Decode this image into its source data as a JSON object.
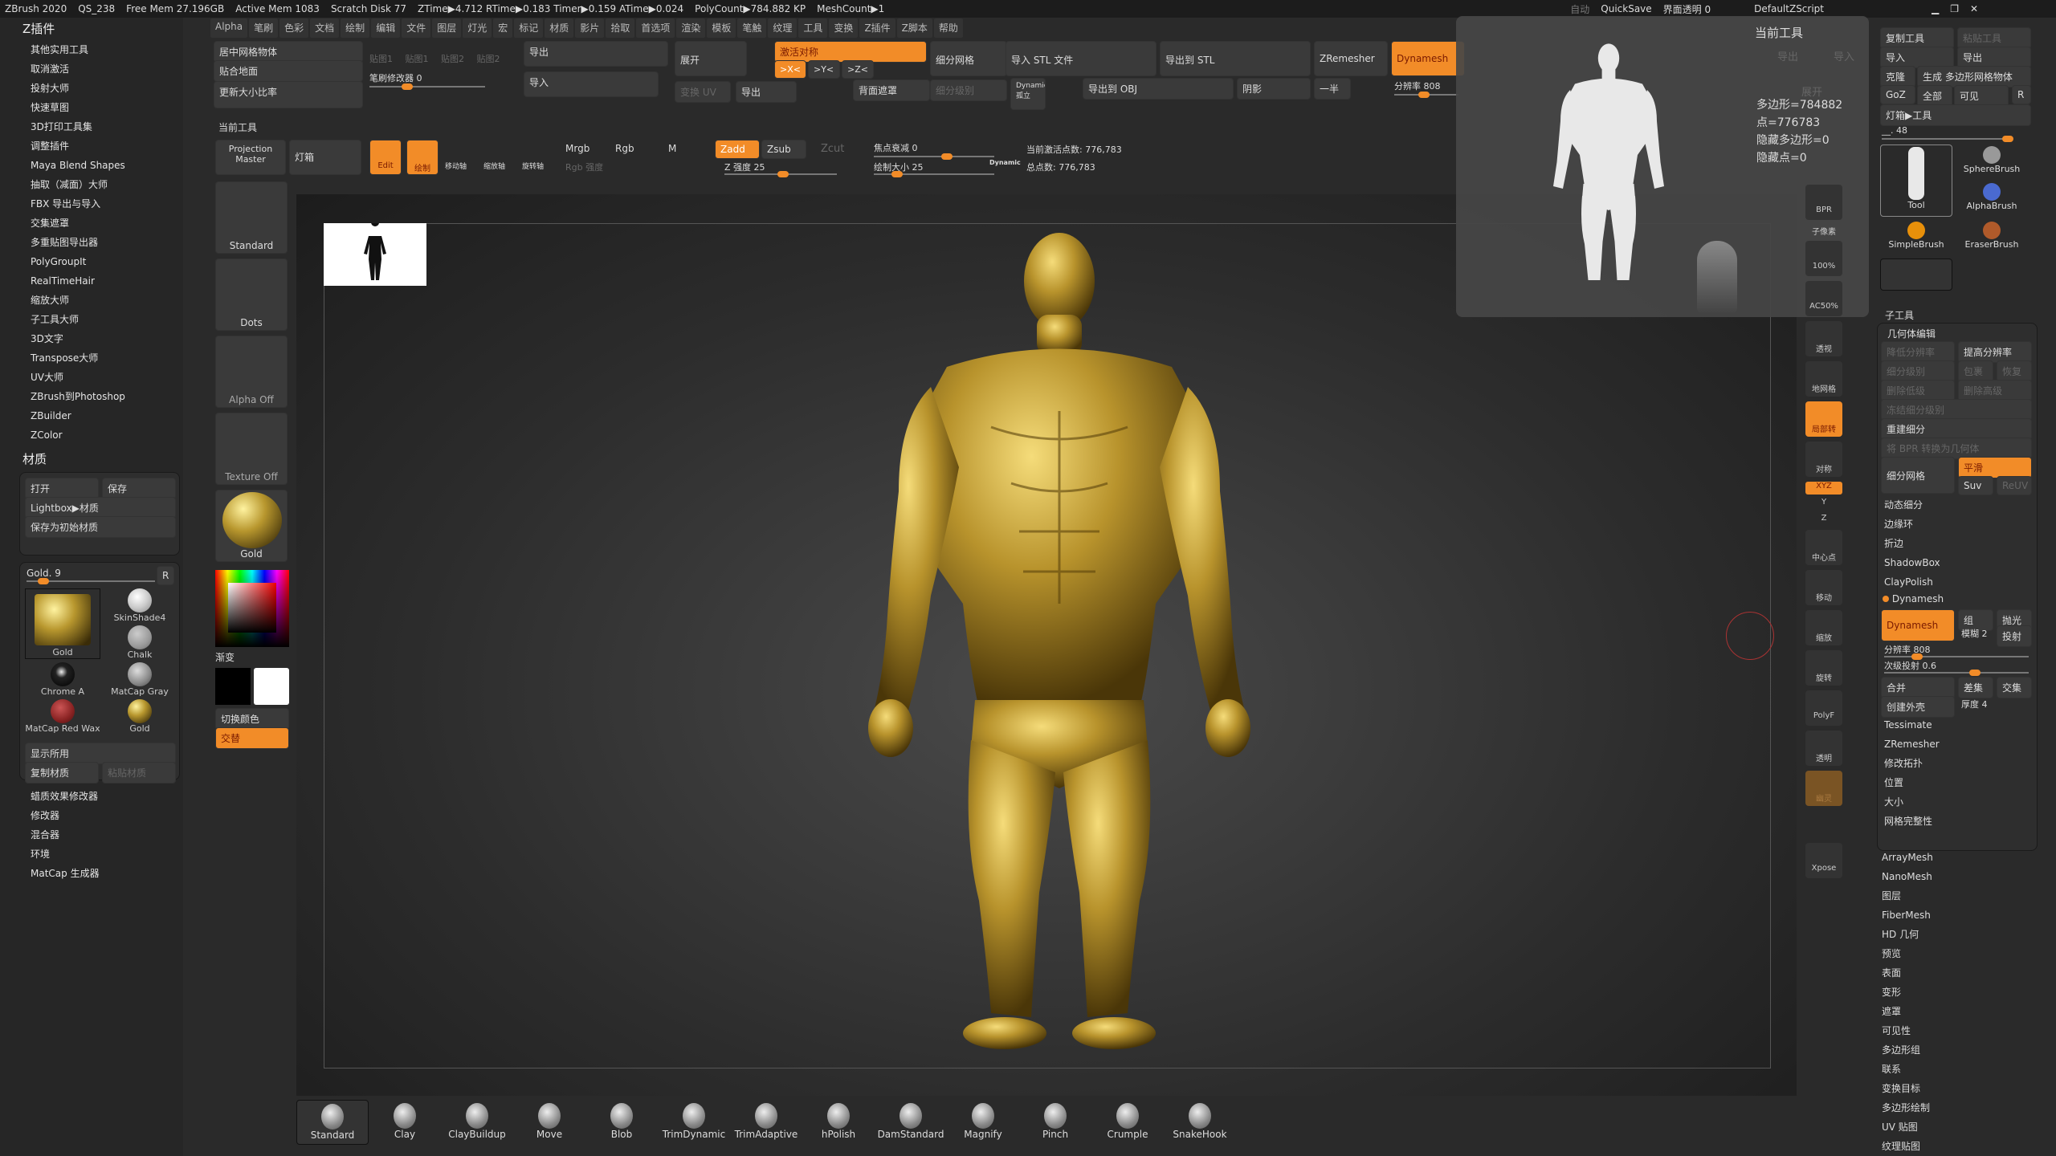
{
  "status": {
    "app": "ZBrush 2020",
    "qs": "QS_238",
    "free_mem": "Free Mem 27.196GB",
    "active_mem": "Active Mem 1083",
    "scratch": "Scratch Disk 77",
    "ztime": "ZTime▶4.712 RTime▶0.183 Timer▶0.159 ATime▶0.024",
    "polycount": "PolyCount▶784.882 KP",
    "meshcount": "MeshCount▶1",
    "auto": "自动",
    "quicksave": "QuickSave",
    "transparency": "界面透明 0",
    "script": "DefaultZScript"
  },
  "menu": [
    "Alpha",
    "笔刷",
    "色彩",
    "文档",
    "绘制",
    "编辑",
    "文件",
    "图层",
    "灯光",
    "宏",
    "标记",
    "材质",
    "影片",
    "拾取",
    "首选项",
    "渲染",
    "模板",
    "笔触",
    "纹理",
    "工具",
    "变换",
    "Z插件",
    "Z脚本",
    "帮助"
  ],
  "left": {
    "title": "Z插件",
    "plugins": [
      "其他实用工具",
      "取消激活",
      "投射大师",
      "快速草图",
      "3D打印工具集",
      "调整插件",
      "Maya Blend Shapes",
      "抽取（减面）大师",
      "FBX 导出与导入",
      "交集遮罩",
      "多重贴图导出器",
      "PolyGroupIt",
      "RealTimeHair",
      "缩放大师",
      "子工具大师",
      "3D文字",
      "Transpose大师",
      "UV大师",
      "ZBrush到Photoshop",
      "ZBuilder",
      "ZColor"
    ],
    "material_title": "材质",
    "open": "打开",
    "save": "保存",
    "lightbox": "Lightbox▶材质",
    "save_start": "保存为初始材质",
    "gold_slider": "Gold. 9",
    "r": "R",
    "materials": [
      "Gold",
      "SkinShade4",
      "Chalk",
      "Chrome A",
      "MatCap Gray",
      "MatCap Red Wax",
      "Gold"
    ],
    "show_used": "显示所用",
    "copy_mat": "复制材质",
    "paste_mat": "粘贴材质",
    "subs": [
      "蜡质效果修改器",
      "修改器",
      "混合器",
      "环境",
      "MatCap 生成器"
    ]
  },
  "top": {
    "center_mesh": "居中网格物体",
    "fit_ground": "贴合地面",
    "update_ratio": "更新大小比率",
    "maps": [
      "贴图1",
      "贴图1",
      "贴图2",
      "贴图2"
    ],
    "brush_mod": "笔刷修改器 0",
    "export": "导出",
    "import": "导入",
    "unwrap": "展开",
    "change_uv": "变换 UV",
    "export2": "导出",
    "activate_sym": "激活对称",
    "x": ">X<",
    "y": ">Y<",
    "z": ">Z<",
    "back_mask": "背面遮罩",
    "divide": "细分网格",
    "sdiv": "细分级别",
    "dynamic": "Dynamic",
    "solo": "孤立",
    "import_stl": "导入 STL 文件",
    "export_stl": "导出到 STL",
    "export_obj": "导出到 OBJ",
    "shadow": "阴影",
    "half": "一半",
    "zremesher": "ZRemesher",
    "dynamesh": "Dynamesh",
    "resolution": "分辨率 808"
  },
  "toolbar": {
    "label": "当前工具",
    "projection": "Projection Master",
    "lightbox": "灯箱",
    "edit": "Edit",
    "draw": "绘制",
    "move": "移动轴",
    "scale": "缩放轴",
    "rotate": "旋转轴",
    "mrgb": "Mrgb",
    "rgb": "Rgb",
    "m": "M",
    "rgb_int": "Rgb 强度",
    "zadd": "Zadd",
    "zsub": "Zsub",
    "zcut": "Zcut",
    "z_int": "Z 强度 25",
    "focal": "焦点衰减 0",
    "draw_size": "绘制大小 25",
    "dyn": "Dynamic",
    "active_pts": "当前激活点数: 776,783",
    "total_pts": "总点数: 776,783"
  },
  "shelf": {
    "brush": "Standard",
    "stroke": "Dots",
    "alpha": "Alpha Off",
    "texture": "Texture Off",
    "material": "Gold",
    "gradient": "渐变",
    "switch": "切换颜色",
    "alternate": "交替"
  },
  "popup": {
    "title": "当前工具",
    "export": "导出",
    "import": "导入",
    "unwrap": "展开",
    "polys": "多边形=784882",
    "points": "点=776783",
    "hidden_polys": "隐藏多边形=0",
    "hidden_pts": "隐藏点=0"
  },
  "rtool": [
    "BPR",
    "子像素",
    "100%",
    "AC50%",
    "透视",
    "地网格",
    "局部转",
    "对称",
    "XYZ",
    "Y",
    "Z",
    "中心点",
    "移动",
    "缩放",
    "旋转",
    "PolyF",
    "透明",
    "幽灵",
    "Xpose"
  ],
  "right": {
    "copy_tool": "复制工具",
    "paste_tool": "粘贴工具",
    "import": "导入",
    "export": "导出",
    "clone": "克隆",
    "make_poly": "生成 多边形网格物体",
    "goz": "GoZ",
    "all": "全部",
    "visible": "可见",
    "r": "R",
    "lightbox": "灯箱▶工具",
    "slider": "__. 48",
    "tools": [
      "Tool",
      "SphereBrush",
      "AlphaBrush",
      "SimpleBrush",
      "EraserBrush"
    ],
    "subtool": "子工具",
    "geometry": "几何体编辑",
    "lower": "降低分辨率",
    "higher": "提高分辨率",
    "sdiv": "细分级别",
    "cage": "包裹",
    "restore": "恢复",
    "del_lower": "删除低级",
    "del_higher": "删除高级",
    "freeze": "冻结细分级别",
    "reconstruct": "重建细分",
    "bpr": "将 BPR 转换为几何体",
    "divide": "细分网格",
    "smooth": "平滑",
    "suv": "Suv",
    "reuv": "ReUV",
    "geo_items": [
      "动态细分",
      "边缘环",
      "折边",
      "ShadowBox",
      "ClayPolish"
    ],
    "dynamesh": "Dynamesh",
    "group": "组",
    "polish": "抛光",
    "blur": "模糊 2",
    "project": "投射",
    "resolution": "分辨率 808",
    "subproj": "次级投射 0.6",
    "add": "合并",
    "sub": "差集",
    "intersect": "交集",
    "shell": "创建外壳",
    "thickness": "厚度 4",
    "geo_items2": [
      "Tessimate",
      "ZRemesher",
      "修改拓扑",
      "位置",
      "大小",
      "网格完整性"
    ],
    "sections": [
      "ArrayMesh",
      "NanoMesh",
      "图层",
      "FiberMesh",
      "HD 几何",
      "预览",
      "表面",
      "变形",
      "遮罩",
      "可见性",
      "多边形组",
      "联系",
      "变换目标",
      "多边形绘制",
      "UV 贴图",
      "纹理贴图"
    ]
  },
  "brushes": [
    "Standard",
    "Clay",
    "ClayBuildup",
    "Move",
    "Blob",
    "TrimDynamic",
    "TrimAdaptive",
    "hPolish",
    "DamStandard",
    "Magnify",
    "Pinch",
    "Crumple",
    "SnakeHook"
  ],
  "colors": {
    "accent": "#f28c28",
    "gold": "#c8a53a"
  }
}
